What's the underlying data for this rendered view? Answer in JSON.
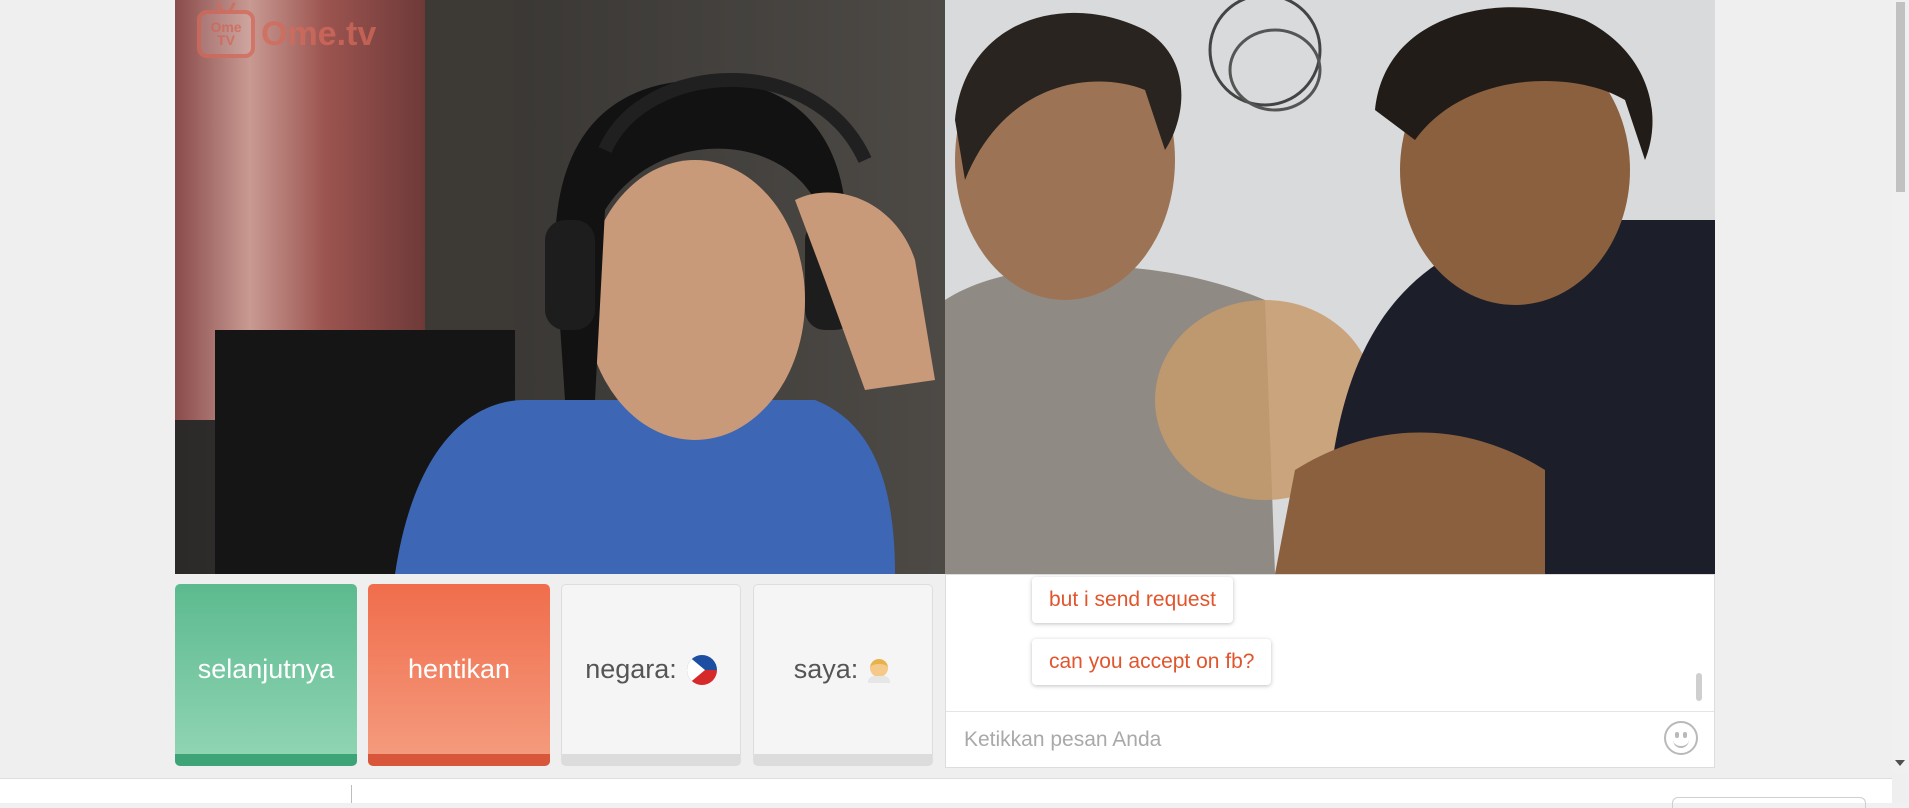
{
  "logo": {
    "badge_top": "Ome",
    "badge_bottom": "TV",
    "text": "Ome.tv"
  },
  "controls": {
    "next_label": "selanjutnya",
    "stop_label": "hentikan",
    "country_label": "negara:",
    "country_icon": "philippines-flag-icon",
    "me_label": "saya:",
    "me_icon": "male-avatar-icon"
  },
  "chat": {
    "messages": [
      {
        "text": "but i send request"
      },
      {
        "text": "can you accept on fb?"
      }
    ],
    "input_placeholder": "Ketikkan pesan Anda",
    "emoji_icon": "smiley-icon"
  },
  "colors": {
    "next_button": "#5cba8f",
    "stop_button": "#f06d4c",
    "message_text": "#e2552c",
    "brand": "#d46a5a"
  }
}
